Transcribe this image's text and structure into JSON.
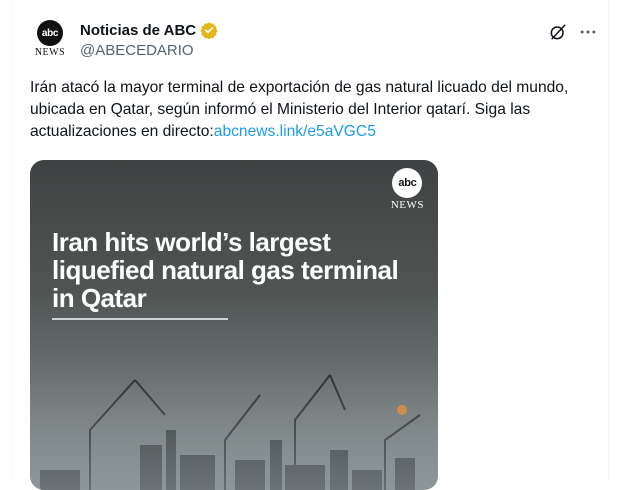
{
  "author": {
    "display_name": "Noticias de ABC",
    "handle": "@ABECEDARIO",
    "avatar_logo_text": "abc",
    "avatar_logo_sub": "NEWS"
  },
  "icons": {
    "verified": "verified-badge-icon",
    "grok": "grok-icon",
    "more": "more-options-icon"
  },
  "tweet": {
    "text": "Irán atacó la mayor terminal de exportación de gas natural licuado del mundo, ubicada en Qatar, según informó el Ministerio del Interior qatarí. Siga las actualizaciones en directo:",
    "link_text": "abcnews.link/e5aVGC5"
  },
  "media": {
    "logo_text": "abc",
    "logo_sub": "NEWS",
    "headline": "Iran hits world’s largest liquefied natural gas terminal in Qatar"
  },
  "colors": {
    "link": "#1d9bf0",
    "verified": "#e2b719",
    "secondary_text": "#536471"
  }
}
